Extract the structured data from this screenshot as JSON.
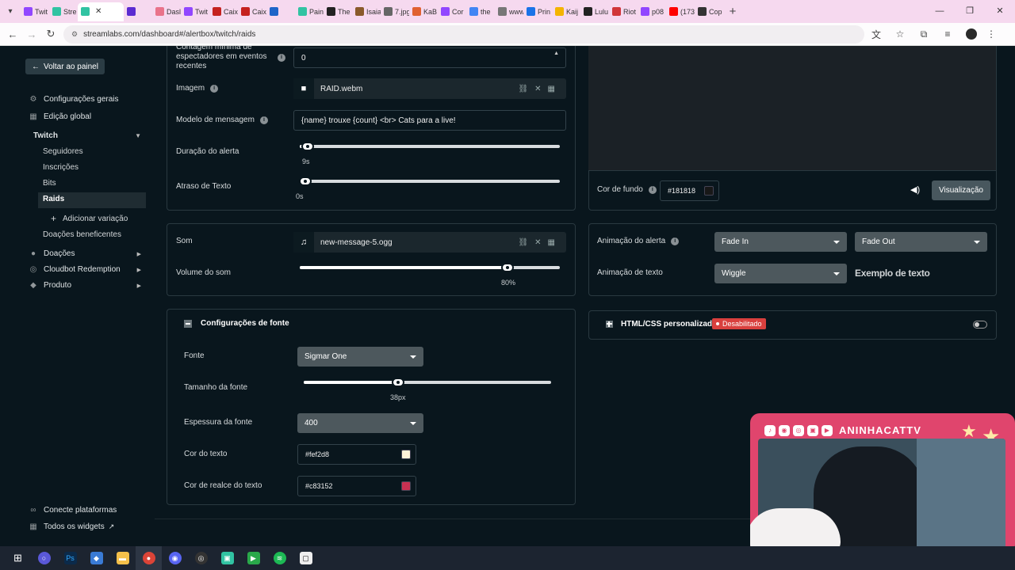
{
  "browser": {
    "tabs": [
      {
        "label": "Twit",
        "color": "#9146ff"
      },
      {
        "label": "Stre",
        "color": "#31c3a2"
      },
      {
        "label": "",
        "color": "#31c3a2",
        "active": true
      },
      {
        "label": "",
        "color": "#5b2bd1"
      },
      {
        "label": "Dasl",
        "color": "#e9738a"
      },
      {
        "label": "Twit",
        "color": "#9146ff"
      },
      {
        "label": "Caix",
        "color": "#c5221f"
      },
      {
        "label": "Caix",
        "color": "#c5221f"
      },
      {
        "label": "",
        "color": "#1e64c8"
      },
      {
        "label": "Pain",
        "color": "#31c3a2"
      },
      {
        "label": "The",
        "color": "#222222"
      },
      {
        "label": "Isaia",
        "color": "#8a5a2b"
      },
      {
        "label": "7.jpg",
        "color": "#666666"
      },
      {
        "label": "KaB",
        "color": "#e06030"
      },
      {
        "label": "Cor",
        "color": "#9146ff"
      },
      {
        "label": "the",
        "color": "#4285f4"
      },
      {
        "label": "www",
        "color": "#777777"
      },
      {
        "label": "Prin",
        "color": "#1a73e8"
      },
      {
        "label": "Kaij",
        "color": "#f4b400"
      },
      {
        "label": "Lulu",
        "color": "#222222"
      },
      {
        "label": "Riot",
        "color": "#d13639"
      },
      {
        "label": "p08",
        "color": "#9146ff"
      },
      {
        "label": "(173",
        "color": "#ff0000"
      },
      {
        "label": "Cop",
        "color": "#333333"
      }
    ],
    "url": "streamlabs.com/dashboard#/alertbox/twitch/raids"
  },
  "sidebar": {
    "back_label": "Voltar ao painel",
    "items": [
      {
        "label": "Configurações gerais",
        "icon": "gear-icon"
      },
      {
        "label": "Edição global",
        "icon": "grid-icon"
      },
      {
        "label": "Twitch"
      },
      {
        "label": "Seguidores"
      },
      {
        "label": "Inscrições"
      },
      {
        "label": "Bits"
      },
      {
        "label": "Raids"
      },
      {
        "label": "Adicionar variação"
      },
      {
        "label": "Doações beneficentes"
      },
      {
        "label": "Doações",
        "icon": "coins-icon"
      },
      {
        "label": "Cloudbot Redemption",
        "icon": "cloudbot-icon"
      },
      {
        "label": "Produto",
        "icon": "tag-icon"
      }
    ],
    "footer": [
      {
        "label": "Conecte plataformas",
        "icon": "link-icon"
      },
      {
        "label": "Todos os widgets",
        "icon": "widgets-icon"
      }
    ]
  },
  "settings": {
    "min_viewers_label": "Contagem mínima de espectadores em eventos recentes",
    "min_viewers_value": "0",
    "image_label": "Imagem",
    "image_file": "RAID.webm",
    "message_label": "Modelo de mensagem",
    "message_value": "{name} trouxe {count} <br> Cats para a live!",
    "duration_label": "Duração do alerta",
    "duration_value": "9s",
    "duration_fraction": 0.03,
    "text_delay_label": "Atraso de Texto",
    "text_delay_value": "0s",
    "text_delay_fraction": 0.0
  },
  "sound": {
    "label": "Som",
    "file": "new-message-5.ogg",
    "volume_label": "Volume do som",
    "volume_value": "80%",
    "volume_fraction": 0.8
  },
  "font": {
    "section_title": "Configurações de fonte",
    "font_label": "Fonte",
    "font_value": "Sigmar One",
    "size_label": "Tamanho da fonte",
    "size_value": "38px",
    "size_fraction": 0.38,
    "weight_label": "Espessura da fonte",
    "weight_value": "400",
    "text_color_label": "Cor do texto",
    "text_color_value": "#fef2d8",
    "highlight_label": "Cor de realce do texto",
    "highlight_value": "#c83152"
  },
  "preview": {
    "bg_label": "Cor de fundo",
    "bg_value": "#181818",
    "button_label": "Visualização"
  },
  "animation": {
    "alert_label": "Animação do alerta",
    "alert_in": "Fade In",
    "alert_out": "Fade Out",
    "text_label": "Animação de texto",
    "text_value": "Wiggle",
    "example_label": "Exemplo de texto"
  },
  "custom": {
    "label": "HTML/CSS personalizado",
    "status": "Desabilitado"
  },
  "webcam": {
    "channel": "ANINHACATTV"
  }
}
